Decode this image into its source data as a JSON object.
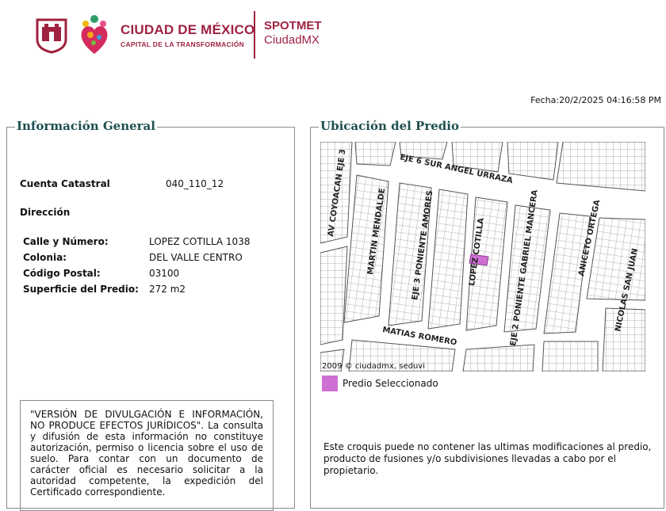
{
  "header": {
    "brand_title": "CIUDAD DE MÉXICO",
    "brand_subtitle": "CAPITAL DE LA TRANSFORMACIÓN",
    "spot_line1": "SPOTMET",
    "spot_line2": "CiudadMX"
  },
  "fecha": "Fecha:20/2/2025 04:16:58 PM",
  "info": {
    "legend": "Información General",
    "cuenta_label": "Cuenta Catastral",
    "cuenta_value": "040_110_12",
    "direccion_label": "Dirección",
    "fields": [
      {
        "label": "Calle y Número:",
        "value": "LOPEZ COTILLA 1038"
      },
      {
        "label": "Colonia:",
        "value": "DEL VALLE CENTRO"
      },
      {
        "label": "Código Postal:",
        "value": "03100"
      },
      {
        "label": "Superficie del Predio:",
        "value": "272 m2"
      }
    ],
    "disclaimer": "\"VERSIÓN DE DIVULGACIÓN E INFORMACIÓN, NO PRODUCE EFECTOS JURÍDICOS\". La consulta y difusión de esta información no constituye autorización, permiso o licencia sobre el uso de suelo. Para contar con un documento de carácter oficial es necesario solicitar a la autoridad competente, la expedición del Certificado correspondiente."
  },
  "ubicacion": {
    "legend": "Ubicación del Predio",
    "streets": {
      "eje6": "EJE 6 SUR ANGEL URRAZA",
      "coyoacan": "AV COYOACAN EJE 3",
      "mendalde": "MARTIN MENDALDE",
      "amores": "EJE 3 PONIENTE AMORES",
      "cotilla": "LOPEZ COTILLA",
      "mancera": "EJE 2 PONIENTE GABRIEL MANCERA",
      "ortega": "ANICETO ORTEGA",
      "sanjuan": "NICOLAS SAN JUAN",
      "romero": "MATIAS ROMERO"
    },
    "copyright": "2009 © ciudadmx, seduvi",
    "selected_color": "#cf6fd3",
    "legend_label": "Predio Seleccionado",
    "note": "Este croquis puede no contener las ultimas modificaciones al predio, producto de fusiones y/o subdivisiones llevadas a cabo por el propietario."
  }
}
